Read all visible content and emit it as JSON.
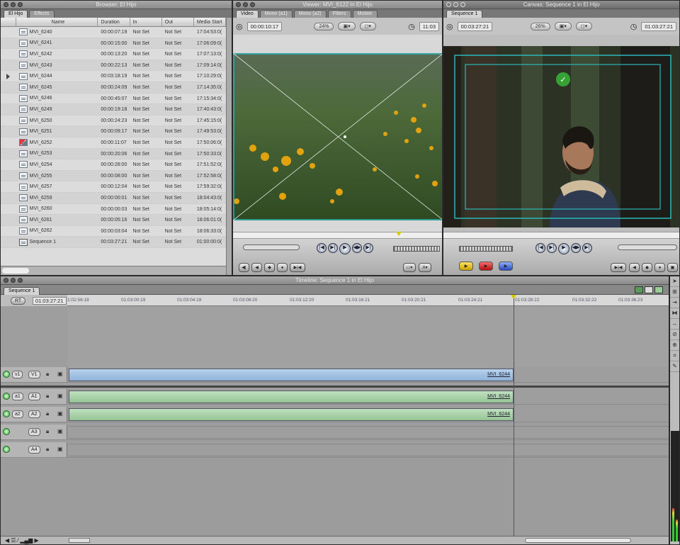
{
  "browser": {
    "title": "Browser: El Hijo",
    "tabs": [
      "El Hijo",
      "Effects"
    ],
    "columns": [
      "Name",
      "Duration",
      "In",
      "Out",
      "Media Start"
    ],
    "rows": [
      [
        "MVI_6240",
        "00:00:07:19",
        "Not Set",
        "Not Set",
        "17:04:53:0("
      ],
      [
        "MVI_6241",
        "00:00:15:00",
        "Not Set",
        "Not Set",
        "17:06:09:0("
      ],
      [
        "MVI_6242",
        "00:00:13:20",
        "Not Set",
        "Not Set",
        "17:07:13:0("
      ],
      [
        "MVI_6243",
        "00:00:22:13",
        "Not Set",
        "Not Set",
        "17:09:14:0("
      ],
      [
        "MVI_6244",
        "00:03:18:19",
        "Not Set",
        "Not Set",
        "17:10:29:0("
      ],
      [
        "MVI_6245",
        "00:00:24:09",
        "Not Set",
        "Not Set",
        "17:14:35:0("
      ],
      [
        "MVI_6246",
        "00:00:45:07",
        "Not Set",
        "Not Set",
        "17:15:34:0("
      ],
      [
        "MVI_6249",
        "00:00:19:18",
        "Not Set",
        "Not Set",
        "17:40:43:0("
      ],
      [
        "MVI_6250",
        "00:00:24:23",
        "Not Set",
        "Not Set",
        "17:45:15:0("
      ],
      [
        "MVI_6251",
        "00:00:09:17",
        "Not Set",
        "Not Set",
        "17:49:53:0("
      ],
      [
        "MVI_6252",
        "00:00:11:07",
        "Not Set",
        "Not Set",
        "17:50:06:0("
      ],
      [
        "MVI_6253",
        "00:00:20:06",
        "Not Set",
        "Not Set",
        "17:50:33:0("
      ],
      [
        "MVI_6254",
        "00:00:28:00",
        "Not Set",
        "Not Set",
        "17:51:52:0("
      ],
      [
        "MVI_6255",
        "00:00:08:00",
        "Not Set",
        "Not Set",
        "17:52:58:0("
      ],
      [
        "MVI_6257",
        "00:00:12:04",
        "Not Set",
        "Not Set",
        "17:59:32:0("
      ],
      [
        "MVI_6259",
        "00:00:00:01",
        "Not Set",
        "Not Set",
        "18:04:43:0("
      ],
      [
        "MVI_6260",
        "00:00:00:03",
        "Not Set",
        "Not Set",
        "18:05:14:0("
      ],
      [
        "MVI_6261",
        "00:00:05:16",
        "Not Set",
        "Not Set",
        "18:06:01:0("
      ],
      [
        "MVI_6262",
        "00:00:03:04",
        "Not Set",
        "Not Set",
        "18:06:33:0("
      ],
      [
        "Sequence 1",
        "00:03:27:21",
        "Not Set",
        "Not Set",
        "01:00:00:0("
      ]
    ]
  },
  "viewer": {
    "title": "Viewer: MVI_6122 in El Hijo",
    "tabs": [
      "Video",
      "Mono (a1)",
      "Mono (a2)",
      "Filters",
      "Motion"
    ],
    "timecode": "00:00:10:17",
    "zoom": "24%",
    "timecode_right": "11:03"
  },
  "canvas": {
    "title": "Canvas: Sequence 1 in El Hijo",
    "tab": "Sequence 1",
    "timecode": "00:03:27:21",
    "zoom": "26%",
    "timecode_right": "01:03:27:21"
  },
  "timeline": {
    "title": "Timeline: Sequence 1 in El Hijo",
    "tab": "Sequence 1",
    "rt": "RT",
    "timecode": "01:03:27:21",
    "ruler": [
      "1:02:56:18",
      "01:03:00:19",
      "01:03:04:19",
      "01:03:08:20",
      "01:03:12:20",
      "01:03:16:21",
      "01:03:20:21",
      "01:03:24:21",
      "01:03:28:22",
      "01:03:32:22",
      "01:03:36:23"
    ],
    "tracks": [
      {
        "src": "v1",
        "dst": "V1",
        "clip": "MVI_6244"
      },
      {
        "src": "a1",
        "dst": "A1",
        "clip": "MVI_6244"
      },
      {
        "src": "a2",
        "dst": "A2",
        "clip": "MVI_6244"
      },
      {
        "src": "",
        "dst": "A3",
        "clip": ""
      },
      {
        "src": "",
        "dst": "A4",
        "clip": ""
      }
    ]
  }
}
